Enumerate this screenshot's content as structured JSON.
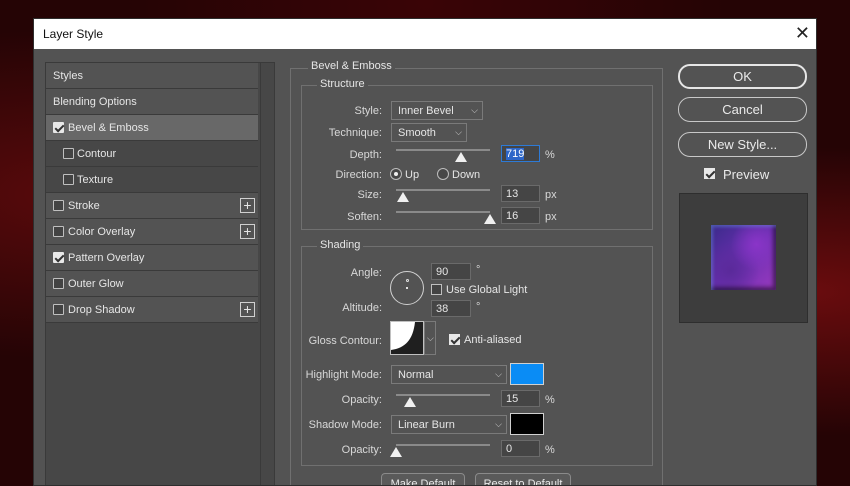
{
  "dialog": {
    "title": "Layer Style",
    "close_glyph": "✕"
  },
  "left_panel": {
    "items": [
      {
        "label": "Styles"
      },
      {
        "label": "Blending Options"
      },
      {
        "label": "Bevel & Emboss",
        "checked": true,
        "selected": true
      },
      {
        "label": "Contour",
        "checked": false,
        "sub": true
      },
      {
        "label": "Texture",
        "checked": false,
        "sub": true
      },
      {
        "label": "Stroke",
        "checked": false,
        "plus": true
      },
      {
        "label": "Color Overlay",
        "checked": false,
        "plus": true
      },
      {
        "label": "Pattern Overlay",
        "checked": true
      },
      {
        "label": "Outer Glow",
        "checked": false
      },
      {
        "label": "Drop Shadow",
        "checked": false,
        "plus": true
      }
    ],
    "plus_glyph": "+"
  },
  "bevel": {
    "section_title": "Bevel & Emboss",
    "structure": {
      "title": "Structure",
      "style_label": "Style:",
      "style_value": "Inner Bevel",
      "technique_label": "Technique:",
      "technique_value": "Smooth",
      "depth_label": "Depth:",
      "depth_value": "719",
      "depth_unit": "%",
      "depth_level": 0.69,
      "direction_label": "Direction:",
      "up_label": "Up",
      "down_label": "Down",
      "direction_value": "Up",
      "size_label": "Size:",
      "size_value": "13",
      "size_unit": "px",
      "size_level": 0.07,
      "soften_label": "Soften:",
      "soften_value": "16",
      "soften_unit": "px",
      "soften_level": 1.0
    },
    "shading": {
      "title": "Shading",
      "angle_label": "Angle:",
      "angle_value": "90",
      "angle_unit": "°",
      "use_global_light_label": "Use Global Light",
      "use_global_light": false,
      "altitude_label": "Altitude:",
      "altitude_value": "38",
      "altitude_unit": "°",
      "gloss_contour_label": "Gloss Contour:",
      "anti_aliased_label": "Anti-aliased",
      "anti_aliased": true,
      "highlight_mode_label": "Highlight Mode:",
      "highlight_mode_value": "Normal",
      "highlight_color": "#0a8cf5",
      "highlight_opacity_label": "Opacity:",
      "highlight_opacity_value": "15",
      "highlight_opacity_unit": "%",
      "highlight_opacity_level": 0.15,
      "shadow_mode_label": "Shadow Mode:",
      "shadow_mode_value": "Linear Burn",
      "shadow_color": "#000000",
      "shadow_opacity_label": "Opacity:",
      "shadow_opacity_value": "0",
      "shadow_opacity_unit": "%",
      "shadow_opacity_level": 0.0
    },
    "make_default_label": "Make Default",
    "reset_default_label": "Reset to Default"
  },
  "right": {
    "ok_label": "OK",
    "cancel_label": "Cancel",
    "new_style_label": "New Style...",
    "preview_label": "Preview",
    "preview_checked": true
  },
  "icons": {
    "chevron": "⌵",
    "degree": "°"
  }
}
